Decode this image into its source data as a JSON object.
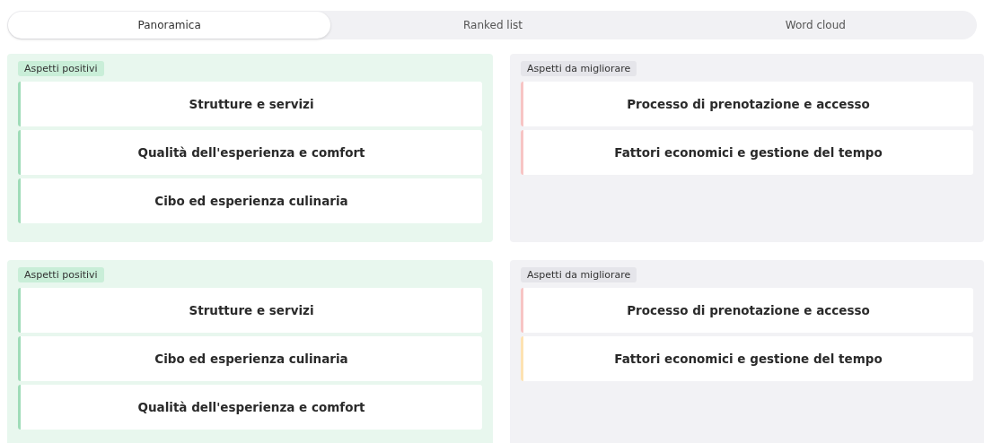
{
  "tabs": [
    {
      "label": "Panoramica",
      "selected": true
    },
    {
      "label": "Ranked list",
      "selected": false
    },
    {
      "label": "Word cloud",
      "selected": false
    }
  ],
  "groups": [
    {
      "panels": [
        {
          "kind": "positive",
          "label": "Aspetti positivi",
          "items": [
            {
              "text": "Strutture e servizi",
              "color": "#9fdcb8"
            },
            {
              "text": "Qualità dell'esperienza e comfort",
              "color": "#9fdcb8"
            },
            {
              "text": "Cibo ed esperienza culinaria",
              "color": "#9fdcb8"
            }
          ]
        },
        {
          "kind": "negative",
          "label": "Aspetti da migliorare",
          "items": [
            {
              "text": "Processo di prenotazione e accesso",
              "color": "#f7c4c4"
            },
            {
              "text": "Fattori economici e gestione del tempo",
              "color": "#f7c4c4"
            }
          ]
        }
      ]
    },
    {
      "panels": [
        {
          "kind": "positive",
          "label": "Aspetti positivi",
          "items": [
            {
              "text": "Strutture e servizi",
              "color": "#9fdcb8"
            },
            {
              "text": "Cibo ed esperienza culinaria",
              "color": "#9fdcb8"
            },
            {
              "text": "Qualità dell'esperienza e comfort",
              "color": "#9fdcb8"
            }
          ]
        },
        {
          "kind": "negative",
          "label": "Aspetti da migliorare",
          "items": [
            {
              "text": "Processo di prenotazione e accesso",
              "color": "#f7c4c4"
            },
            {
              "text": "Fattori economici e gestione del tempo",
              "color": "#fde2b2"
            }
          ]
        }
      ]
    }
  ]
}
